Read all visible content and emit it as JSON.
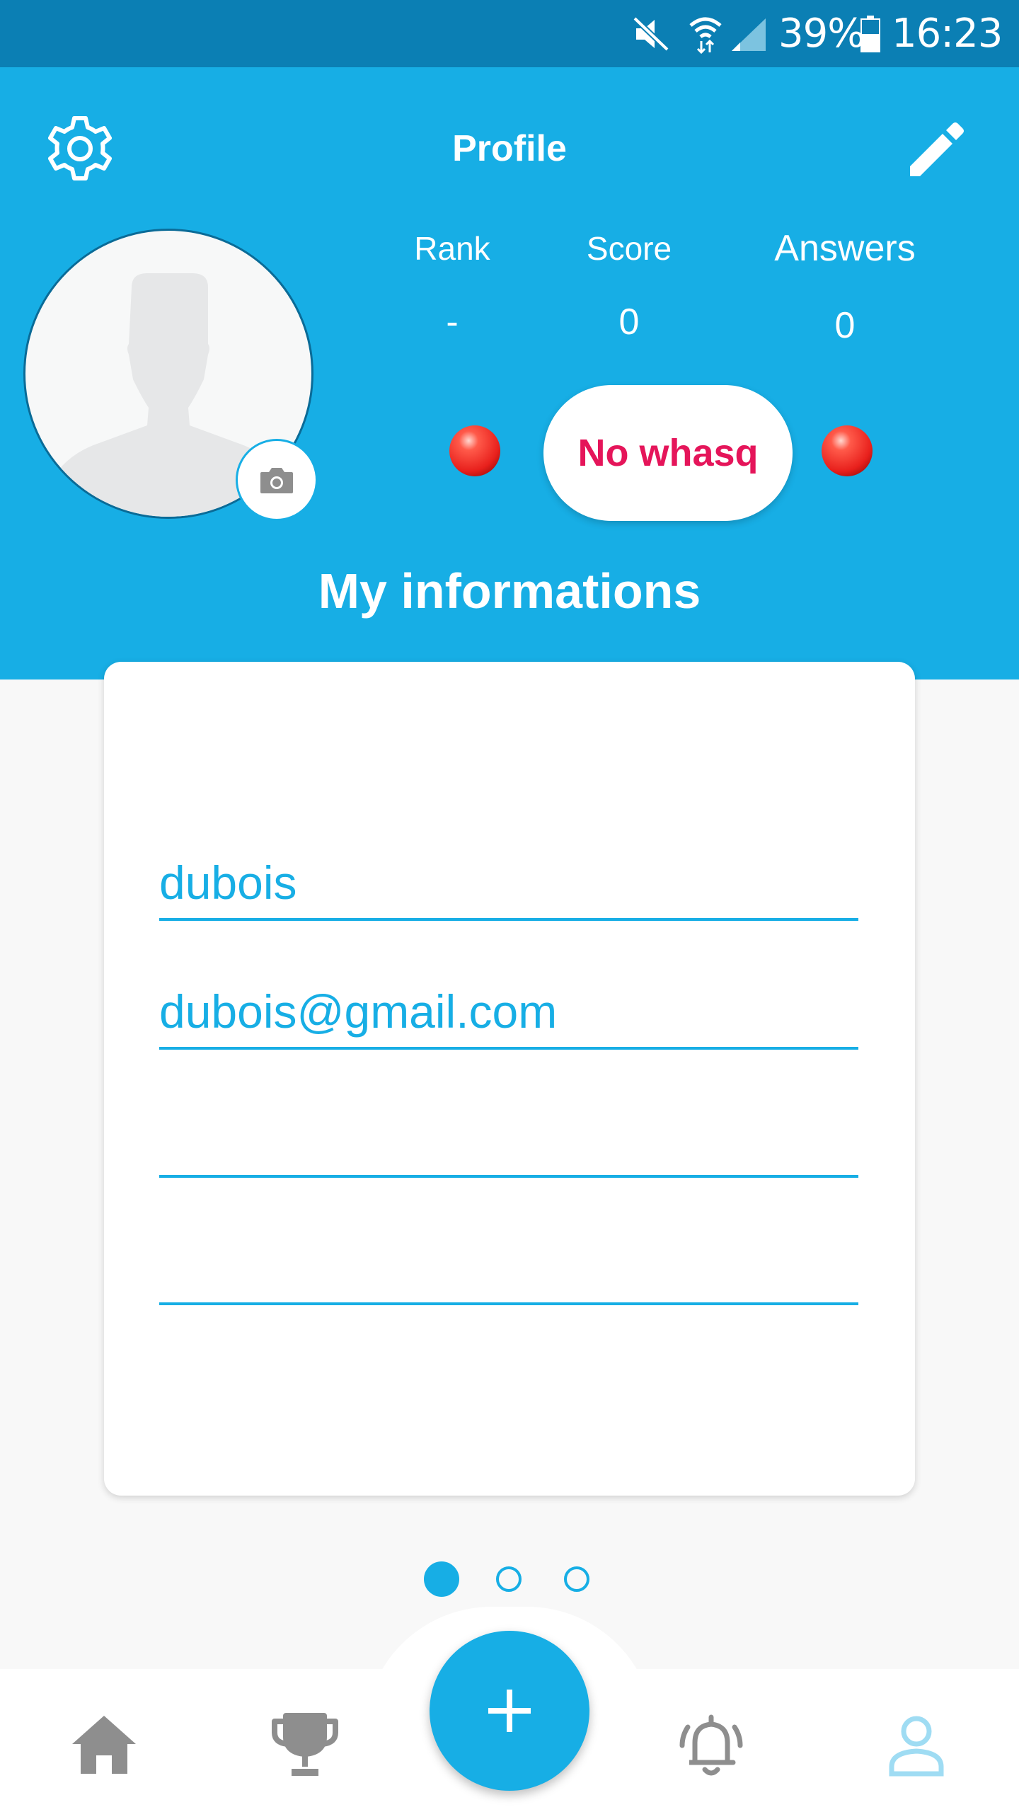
{
  "status_bar": {
    "battery": "39%",
    "time": "16:23",
    "icons": [
      "mute-icon",
      "wifi-icon",
      "signal-icon",
      "battery-icon"
    ]
  },
  "header": {
    "title": "Profile",
    "settings_icon": "gear-icon",
    "edit_icon": "pencil-icon"
  },
  "stats": {
    "rank": {
      "label": "Rank",
      "value": "-"
    },
    "score": {
      "label": "Score",
      "value": "0"
    },
    "answers": {
      "label": "Answers",
      "value": "0"
    }
  },
  "whasq_button": {
    "label": "No whasq"
  },
  "section": {
    "title": "My informations"
  },
  "form": {
    "username": "dubois",
    "email": "dubois@gmail.com",
    "field3": "",
    "field4": ""
  },
  "pager": {
    "current_page": 1,
    "page_count": 3
  },
  "bottom_nav": {
    "items": [
      "home-icon",
      "trophy-icon",
      "add-icon",
      "bell-icon",
      "user-icon"
    ],
    "active": "user-icon"
  },
  "colors": {
    "primary": "#17aee5",
    "status_bar": "#0b7fb4",
    "accent": "#e5155a",
    "inactive_icon": "#8e8e8e",
    "active_icon": "#9fdcf3",
    "background": "#f8f8f8"
  }
}
